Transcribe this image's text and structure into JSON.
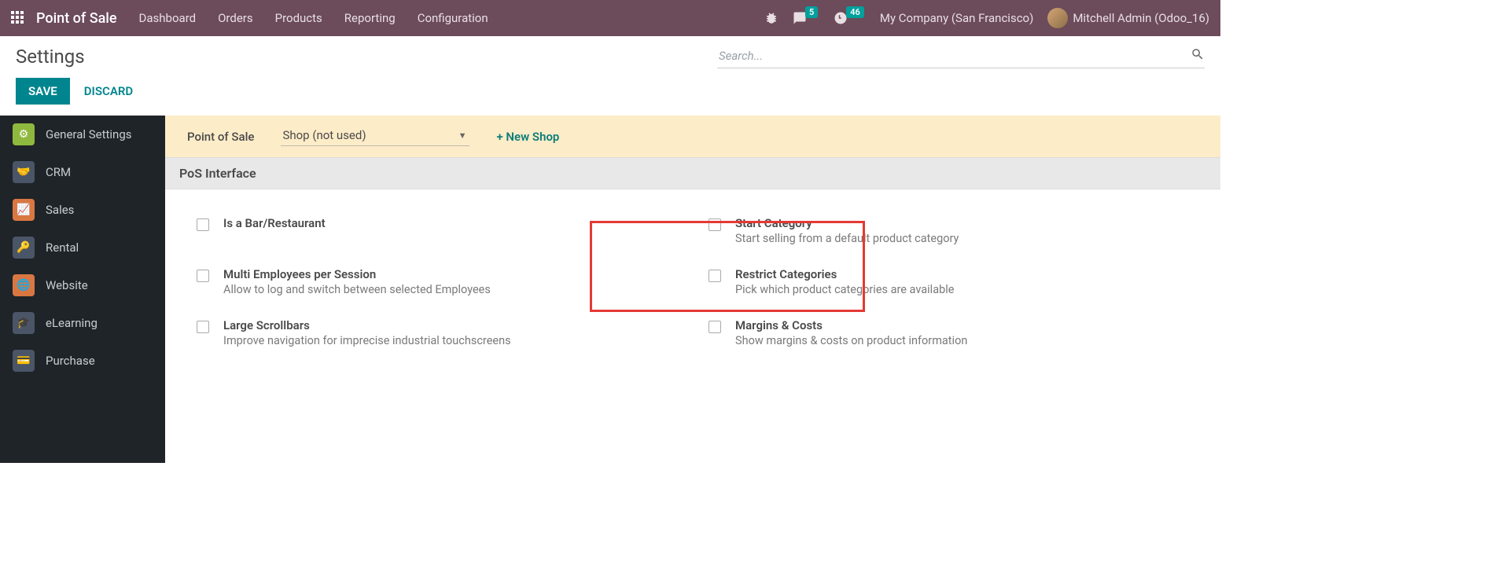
{
  "topnav": {
    "brand": "Point of Sale",
    "links": [
      "Dashboard",
      "Orders",
      "Products",
      "Reporting",
      "Configuration"
    ],
    "msg_badge": "5",
    "activity_badge": "46",
    "company": "My Company (San Francisco)",
    "user": "Mitchell Admin (Odoo_16)"
  },
  "page": {
    "title": "Settings",
    "search_placeholder": "Search...",
    "save": "SAVE",
    "discard": "DISCARD"
  },
  "sidebar": {
    "items": [
      {
        "label": "General Settings"
      },
      {
        "label": "CRM"
      },
      {
        "label": "Sales"
      },
      {
        "label": "Rental"
      },
      {
        "label": "Website"
      },
      {
        "label": "eLearning"
      },
      {
        "label": "Purchase"
      }
    ]
  },
  "configbar": {
    "label": "Point of Sale",
    "selected_shop": "Shop (not used)",
    "new_shop": "+ New Shop"
  },
  "section": {
    "header": "PoS Interface"
  },
  "settings": {
    "bar_restaurant": {
      "title": "Is a Bar/Restaurant",
      "desc": ""
    },
    "start_category": {
      "title": "Start Category",
      "desc": "Start selling from a default product category"
    },
    "multi_employees": {
      "title": "Multi Employees per Session",
      "desc": "Allow to log and switch between selected Employees"
    },
    "restrict_categories": {
      "title": "Restrict Categories",
      "desc": "Pick which product categories are available"
    },
    "large_scrollbars": {
      "title": "Large Scrollbars",
      "desc": "Improve navigation for imprecise industrial touchscreens"
    },
    "margins_costs": {
      "title": "Margins & Costs",
      "desc": "Show margins & costs on product information"
    }
  }
}
